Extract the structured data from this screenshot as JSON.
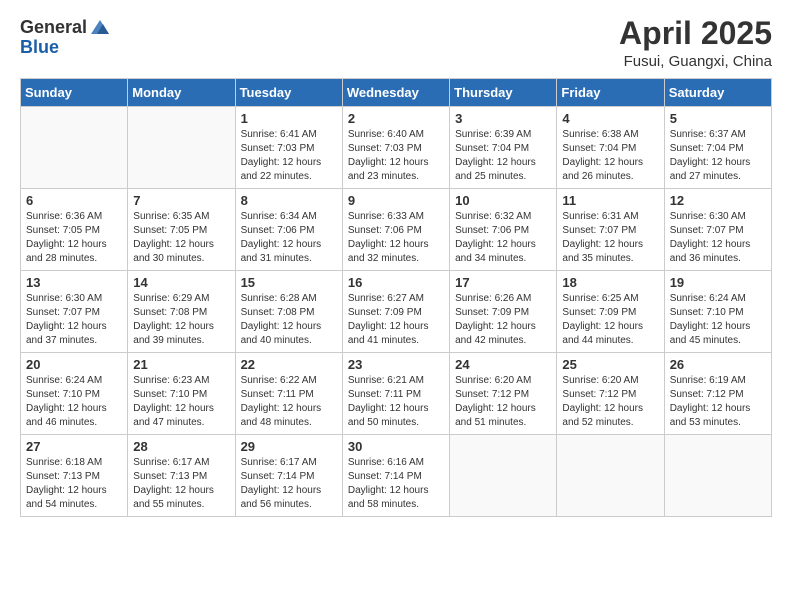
{
  "logo": {
    "general": "General",
    "blue": "Blue"
  },
  "title": {
    "month_year": "April 2025",
    "location": "Fusui, Guangxi, China"
  },
  "days_of_week": [
    "Sunday",
    "Monday",
    "Tuesday",
    "Wednesday",
    "Thursday",
    "Friday",
    "Saturday"
  ],
  "weeks": [
    [
      {
        "day": "",
        "detail": ""
      },
      {
        "day": "",
        "detail": ""
      },
      {
        "day": "1",
        "detail": "Sunrise: 6:41 AM\nSunset: 7:03 PM\nDaylight: 12 hours and 22 minutes."
      },
      {
        "day": "2",
        "detail": "Sunrise: 6:40 AM\nSunset: 7:03 PM\nDaylight: 12 hours and 23 minutes."
      },
      {
        "day": "3",
        "detail": "Sunrise: 6:39 AM\nSunset: 7:04 PM\nDaylight: 12 hours and 25 minutes."
      },
      {
        "day": "4",
        "detail": "Sunrise: 6:38 AM\nSunset: 7:04 PM\nDaylight: 12 hours and 26 minutes."
      },
      {
        "day": "5",
        "detail": "Sunrise: 6:37 AM\nSunset: 7:04 PM\nDaylight: 12 hours and 27 minutes."
      }
    ],
    [
      {
        "day": "6",
        "detail": "Sunrise: 6:36 AM\nSunset: 7:05 PM\nDaylight: 12 hours and 28 minutes."
      },
      {
        "day": "7",
        "detail": "Sunrise: 6:35 AM\nSunset: 7:05 PM\nDaylight: 12 hours and 30 minutes."
      },
      {
        "day": "8",
        "detail": "Sunrise: 6:34 AM\nSunset: 7:06 PM\nDaylight: 12 hours and 31 minutes."
      },
      {
        "day": "9",
        "detail": "Sunrise: 6:33 AM\nSunset: 7:06 PM\nDaylight: 12 hours and 32 minutes."
      },
      {
        "day": "10",
        "detail": "Sunrise: 6:32 AM\nSunset: 7:06 PM\nDaylight: 12 hours and 34 minutes."
      },
      {
        "day": "11",
        "detail": "Sunrise: 6:31 AM\nSunset: 7:07 PM\nDaylight: 12 hours and 35 minutes."
      },
      {
        "day": "12",
        "detail": "Sunrise: 6:30 AM\nSunset: 7:07 PM\nDaylight: 12 hours and 36 minutes."
      }
    ],
    [
      {
        "day": "13",
        "detail": "Sunrise: 6:30 AM\nSunset: 7:07 PM\nDaylight: 12 hours and 37 minutes."
      },
      {
        "day": "14",
        "detail": "Sunrise: 6:29 AM\nSunset: 7:08 PM\nDaylight: 12 hours and 39 minutes."
      },
      {
        "day": "15",
        "detail": "Sunrise: 6:28 AM\nSunset: 7:08 PM\nDaylight: 12 hours and 40 minutes."
      },
      {
        "day": "16",
        "detail": "Sunrise: 6:27 AM\nSunset: 7:09 PM\nDaylight: 12 hours and 41 minutes."
      },
      {
        "day": "17",
        "detail": "Sunrise: 6:26 AM\nSunset: 7:09 PM\nDaylight: 12 hours and 42 minutes."
      },
      {
        "day": "18",
        "detail": "Sunrise: 6:25 AM\nSunset: 7:09 PM\nDaylight: 12 hours and 44 minutes."
      },
      {
        "day": "19",
        "detail": "Sunrise: 6:24 AM\nSunset: 7:10 PM\nDaylight: 12 hours and 45 minutes."
      }
    ],
    [
      {
        "day": "20",
        "detail": "Sunrise: 6:24 AM\nSunset: 7:10 PM\nDaylight: 12 hours and 46 minutes."
      },
      {
        "day": "21",
        "detail": "Sunrise: 6:23 AM\nSunset: 7:10 PM\nDaylight: 12 hours and 47 minutes."
      },
      {
        "day": "22",
        "detail": "Sunrise: 6:22 AM\nSunset: 7:11 PM\nDaylight: 12 hours and 48 minutes."
      },
      {
        "day": "23",
        "detail": "Sunrise: 6:21 AM\nSunset: 7:11 PM\nDaylight: 12 hours and 50 minutes."
      },
      {
        "day": "24",
        "detail": "Sunrise: 6:20 AM\nSunset: 7:12 PM\nDaylight: 12 hours and 51 minutes."
      },
      {
        "day": "25",
        "detail": "Sunrise: 6:20 AM\nSunset: 7:12 PM\nDaylight: 12 hours and 52 minutes."
      },
      {
        "day": "26",
        "detail": "Sunrise: 6:19 AM\nSunset: 7:12 PM\nDaylight: 12 hours and 53 minutes."
      }
    ],
    [
      {
        "day": "27",
        "detail": "Sunrise: 6:18 AM\nSunset: 7:13 PM\nDaylight: 12 hours and 54 minutes."
      },
      {
        "day": "28",
        "detail": "Sunrise: 6:17 AM\nSunset: 7:13 PM\nDaylight: 12 hours and 55 minutes."
      },
      {
        "day": "29",
        "detail": "Sunrise: 6:17 AM\nSunset: 7:14 PM\nDaylight: 12 hours and 56 minutes."
      },
      {
        "day": "30",
        "detail": "Sunrise: 6:16 AM\nSunset: 7:14 PM\nDaylight: 12 hours and 58 minutes."
      },
      {
        "day": "",
        "detail": ""
      },
      {
        "day": "",
        "detail": ""
      },
      {
        "day": "",
        "detail": ""
      }
    ]
  ]
}
